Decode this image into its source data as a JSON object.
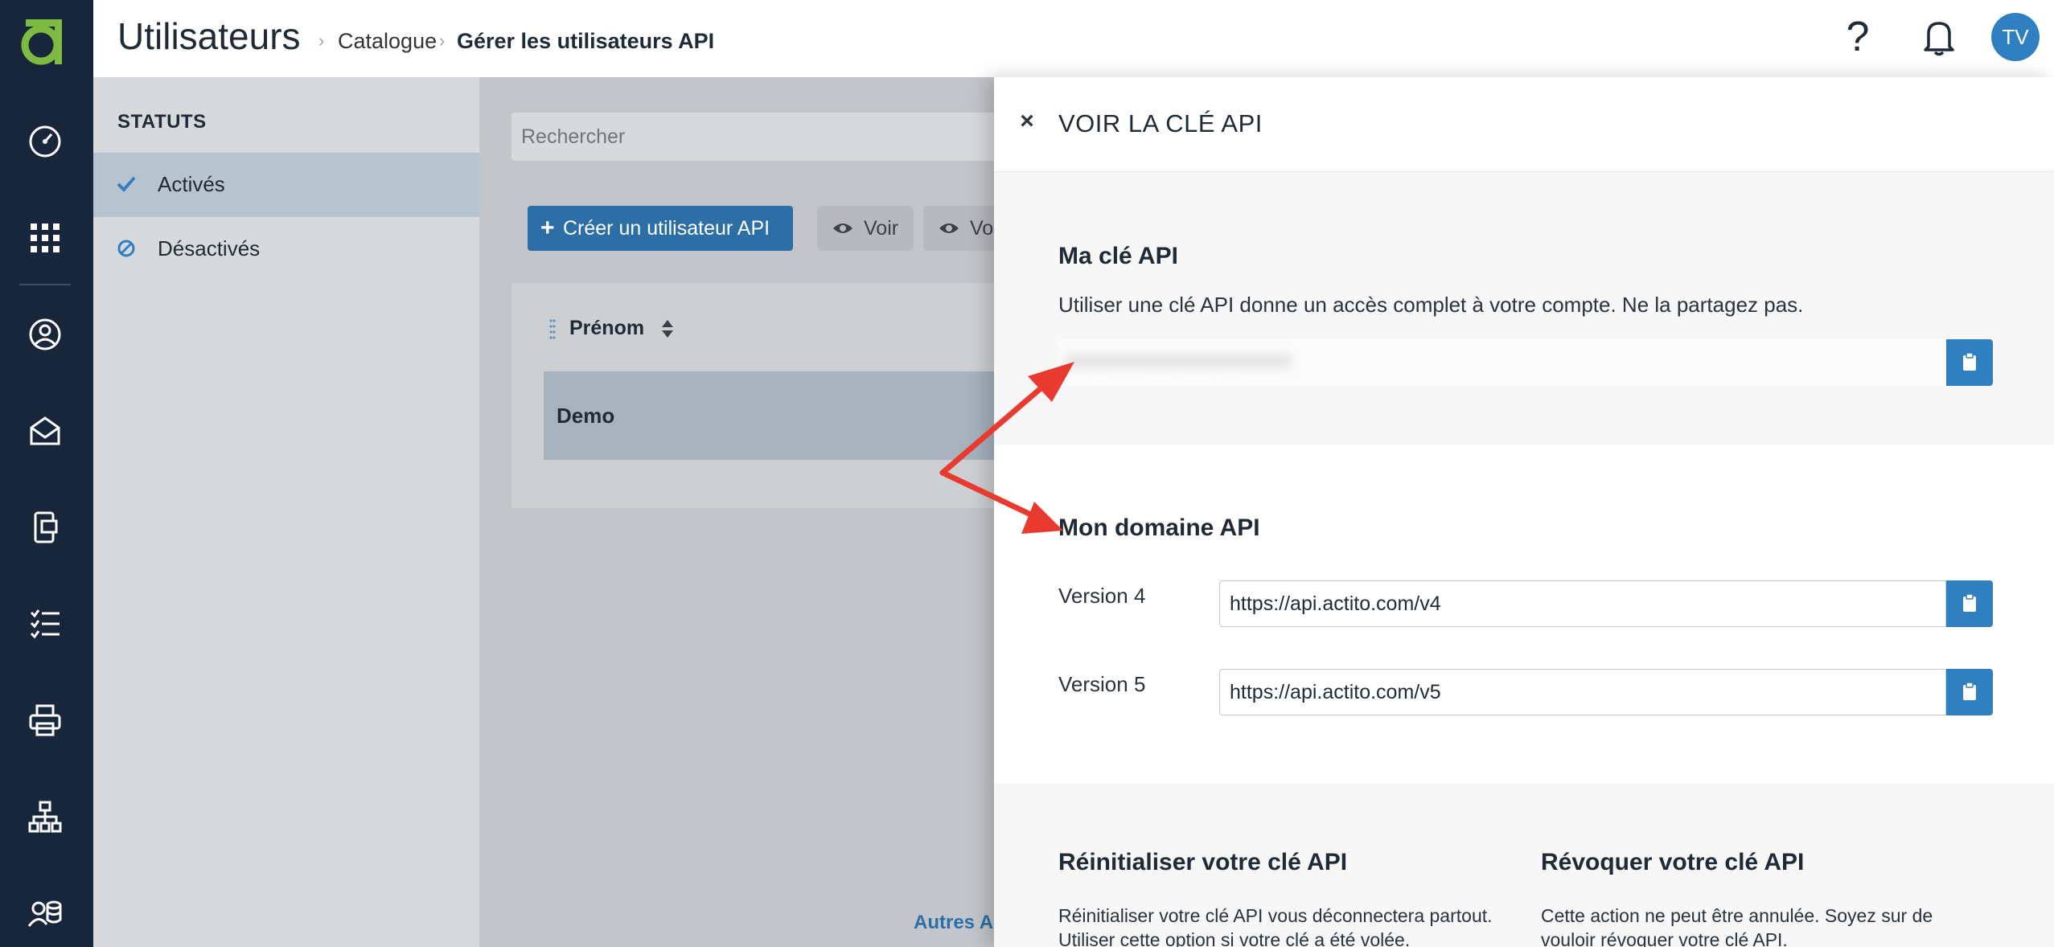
{
  "header": {
    "title": "Utilisateurs",
    "breadcrumb": [
      "Catalogue",
      "Gérer les utilisateurs API"
    ],
    "avatar_initials": "TV"
  },
  "leftnav": {
    "items": [
      "dashboard-icon",
      "apps-grid-icon",
      "user-circle-icon",
      "email-icon",
      "mobile-form-icon",
      "checklist-icon",
      "printer-icon",
      "sitemap-icon",
      "users-data-icon"
    ]
  },
  "status": {
    "title": "STATUTS",
    "items": [
      {
        "label": "Activés",
        "active": true
      },
      {
        "label": "Désactivés",
        "active": false
      }
    ]
  },
  "main": {
    "search_placeholder": "Rechercher",
    "create_button": "Créer un utilisateur API",
    "view_buttons": [
      "Voir",
      "Voi"
    ],
    "column_header": "Prénom",
    "rows": [
      {
        "first_name": "Demo"
      }
    ],
    "other_actions": "Autres Ac"
  },
  "drawer": {
    "title": "VOIR LA CLÉ API",
    "key_section": {
      "title": "Ma clé API",
      "description": "Utiliser une clé API donne un accès complet à votre compte. Ne la partagez pas.",
      "key_value": "ffffffffffffffffffffffffffffffffff"
    },
    "domain_section": {
      "title": "Mon domaine API",
      "versions": [
        {
          "label": "Version 4",
          "url": "https://api.actito.com/v4"
        },
        {
          "label": "Version 5",
          "url": "https://api.actito.com/v5"
        }
      ]
    },
    "reset": {
      "title": "Réinitialiser votre clé API",
      "description": "Réinitialiser votre clé API vous déconnectera partout. Utiliser cette option si votre clé a été volée."
    },
    "revoke": {
      "title": "Révoquer votre clé API",
      "description": "Cette action ne peut être annulée. Soyez sur de vouloir révoquer votre clé API."
    }
  },
  "colors": {
    "nav_bg": "#17263a",
    "accent": "#2f7fc1",
    "logo": "#7dbb42",
    "annotation_arrow": "#e83a2f"
  }
}
